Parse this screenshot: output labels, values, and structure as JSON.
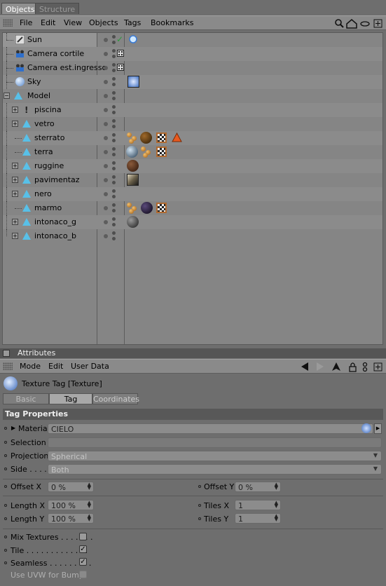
{
  "tabs": {
    "objects": "Objects",
    "structure": "Structure"
  },
  "obj_menu": [
    "File",
    "Edit",
    "View",
    "Objects",
    "Tags",
    "Bookmarks"
  ],
  "objects": [
    {
      "name": "Sun",
      "icon": "sun-light-icon",
      "tags": [
        "sun-tag"
      ]
    },
    {
      "name": "Camera cortile",
      "icon": "camera-icon",
      "tags": [
        "camera-protection-tag"
      ]
    },
    {
      "name": "Camera est.ingresso",
      "icon": "camera-icon",
      "tags": [
        "camera-protection-tag"
      ]
    },
    {
      "name": "Sky",
      "icon": "sky-icon",
      "tags": [
        "sky-texture-tag"
      ]
    },
    {
      "name": "Model",
      "icon": "polygon-object-icon",
      "tags": []
    },
    {
      "name": "piscina",
      "icon": "light-icon",
      "tags": []
    },
    {
      "name": "vetro",
      "icon": "polygon-object-icon",
      "tags": []
    },
    {
      "name": "sterrato",
      "icon": "polygon-object-icon",
      "tags": [
        "uvw-tag",
        "brown-material",
        "checker-texture",
        "phong-tag"
      ]
    },
    {
      "name": "terra",
      "icon": "polygon-object-icon",
      "tags": [
        "blue-material",
        "uvw-tag",
        "checker-texture"
      ]
    },
    {
      "name": "ruggine",
      "icon": "polygon-object-icon",
      "tags": [
        "rust-material"
      ]
    },
    {
      "name": "pavimentaz",
      "icon": "polygon-object-icon",
      "tags": [
        "floor-material"
      ]
    },
    {
      "name": "nero",
      "icon": "polygon-object-icon",
      "tags": []
    },
    {
      "name": "marmo",
      "icon": "polygon-object-icon",
      "tags": [
        "uvw-tag",
        "dark-material",
        "checker-texture"
      ]
    },
    {
      "name": "intonaco_g",
      "icon": "polygon-object-icon",
      "tags": [
        "grey-material"
      ]
    },
    {
      "name": "intonaco_b",
      "icon": "polygon-object-icon",
      "tags": []
    }
  ],
  "attributes": {
    "title": "Attributes",
    "menu": [
      "Mode",
      "Edit",
      "User Data"
    ],
    "tag_name": "Texture Tag [Texture]",
    "subtabs": [
      "Basic",
      "Tag",
      "Coordinates"
    ],
    "section": "Tag Properties",
    "material_label": "Material",
    "material_value": "CIELO",
    "selection_label": "Selection",
    "selection_value": "",
    "projection_label": "Projection",
    "projection_value": "Spherical",
    "side_label": "Side . . . .",
    "side_value": "Both",
    "offset_x_label": "Offset X",
    "offset_x_value": "0 %",
    "offset_y_label": "Offset Y",
    "offset_y_value": "0 %",
    "length_x_label": "Length X",
    "length_x_value": "100 %",
    "tiles_x_label": "Tiles X",
    "tiles_x_value": "1",
    "length_y_label": "Length Y",
    "length_y_value": "100 %",
    "tiles_y_label": "Tiles Y",
    "tiles_y_value": "1",
    "mix_label": "Mix Textures . . . . . . .",
    "mix_checked": false,
    "tile_label": "Tile . . . . . . . . . . . . .",
    "tile_checked": true,
    "seamless_label": "Seamless . . . . . . . . .",
    "seamless_checked": true,
    "uvw_label": "Use UVW for Bump",
    "uvw_checked": false
  }
}
